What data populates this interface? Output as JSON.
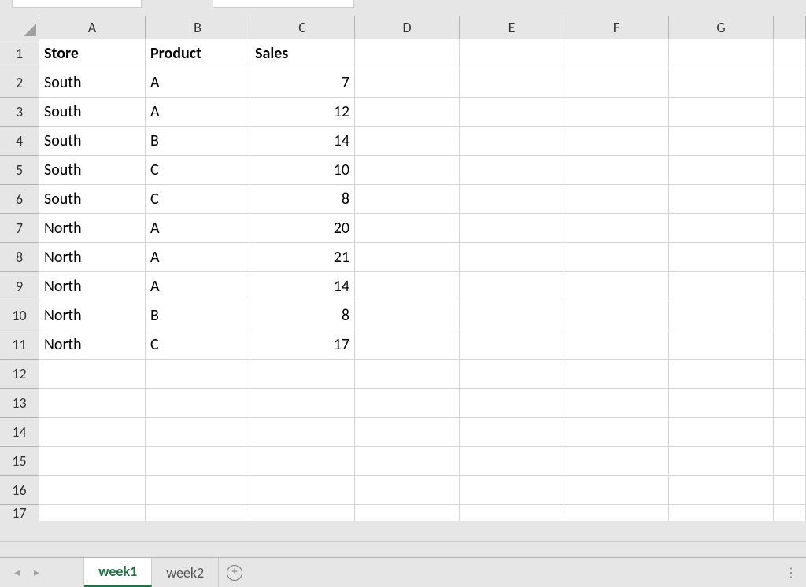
{
  "columns": [
    "A",
    "B",
    "C",
    "D",
    "E",
    "F",
    "G"
  ],
  "rowNumbers": [
    "1",
    "2",
    "3",
    "4",
    "5",
    "6",
    "7",
    "8",
    "9",
    "10",
    "11",
    "12",
    "13",
    "14",
    "15",
    "16",
    "17"
  ],
  "headers": {
    "a": "Store",
    "b": "Product",
    "c": "Sales"
  },
  "data": [
    {
      "store": "South",
      "product": "A",
      "sales": "7"
    },
    {
      "store": "South",
      "product": "A",
      "sales": "12"
    },
    {
      "store": "South",
      "product": "B",
      "sales": "14"
    },
    {
      "store": "South",
      "product": "C",
      "sales": "10"
    },
    {
      "store": "South",
      "product": "C",
      "sales": "8"
    },
    {
      "store": "North",
      "product": "A",
      "sales": "20"
    },
    {
      "store": "North",
      "product": "A",
      "sales": "21"
    },
    {
      "store": "North",
      "product": "A",
      "sales": "14"
    },
    {
      "store": "North",
      "product": "B",
      "sales": "8"
    },
    {
      "store": "North",
      "product": "C",
      "sales": "17"
    }
  ],
  "sheetTabs": {
    "active": "week1",
    "inactive": "week2"
  },
  "icons": {
    "plus": "+",
    "navLeft": "◂",
    "navRight": "▸",
    "dots": "⋮"
  }
}
